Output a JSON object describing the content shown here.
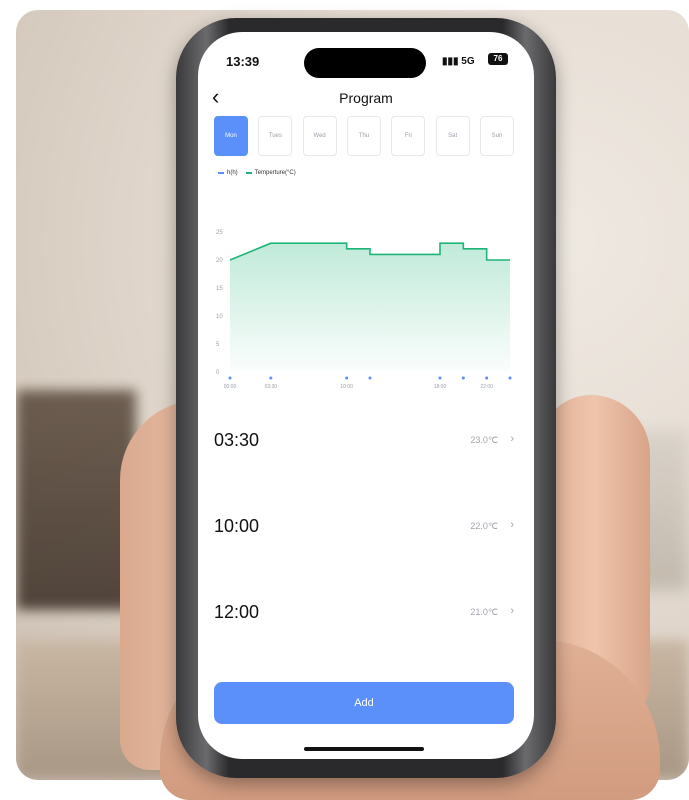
{
  "status_bar": {
    "time": "13:39",
    "signal": "5G",
    "battery": "76"
  },
  "header": {
    "title": "Program",
    "back_icon": "chevron-left-icon"
  },
  "days": [
    {
      "label": "Mon",
      "active": true
    },
    {
      "label": "Tues",
      "active": false
    },
    {
      "label": "Wed",
      "active": false
    },
    {
      "label": "Thu",
      "active": false
    },
    {
      "label": "Fri",
      "active": false
    },
    {
      "label": "Sat",
      "active": false
    },
    {
      "label": "Sun",
      "active": false
    }
  ],
  "legend": [
    {
      "label": "h(h)",
      "color": "#5b8ff9"
    },
    {
      "label": "Temperture(°C)",
      "color": "#1fb578"
    }
  ],
  "chart_data": {
    "type": "area",
    "xlim": [
      0,
      24
    ],
    "ylim": [
      0,
      25
    ],
    "yticks": [
      "0",
      "5",
      "10",
      "15",
      "20",
      "25"
    ],
    "xticks": [
      {
        "x": 0,
        "label": "00:00"
      },
      {
        "x": 3.5,
        "label": "03:30"
      },
      {
        "x": 10,
        "label": "10:00"
      },
      {
        "x": 18,
        "label": "18:00"
      },
      {
        "x": 22,
        "label": "22:00"
      }
    ],
    "step_series": {
      "name": "Temperture(°C)",
      "points": [
        [
          0,
          20
        ],
        [
          3.5,
          23
        ],
        [
          10,
          23
        ],
        [
          10,
          22
        ],
        [
          12,
          22
        ],
        [
          12,
          21
        ],
        [
          18,
          21
        ],
        [
          18,
          23
        ],
        [
          20,
          23
        ],
        [
          20,
          22
        ],
        [
          22,
          22
        ],
        [
          22,
          20
        ],
        [
          24,
          20
        ]
      ]
    },
    "markers": {
      "name": "h(h)",
      "x": [
        0,
        3.5,
        10,
        12,
        18,
        20,
        22,
        24
      ]
    }
  },
  "schedule": [
    {
      "time": "03:30",
      "temp": "23.0℃"
    },
    {
      "time": "10:00",
      "temp": "22.0℃"
    },
    {
      "time": "12:00",
      "temp": "21.0℃"
    }
  ],
  "add_button": {
    "label": "Add"
  },
  "colors": {
    "accent": "#5b8ff9",
    "line": "#1fb578"
  }
}
